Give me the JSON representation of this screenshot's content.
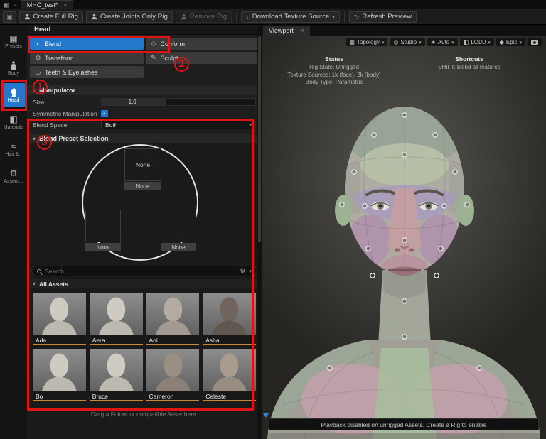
{
  "colors": {
    "accent": "#2478cc",
    "underline": "#c9882e",
    "annotation": "#e01414"
  },
  "titlebar": {
    "tab": "MHC_test*"
  },
  "toolbar": {
    "create_full_rig": "Create Full Rig",
    "create_joints_only_rig": "Create Joints Only Rig",
    "remove_rig": "Remove Rig",
    "download_texture_source": "Download Texture Source",
    "refresh_preview": "Refresh Preview"
  },
  "sidebar": {
    "items": [
      {
        "label": "Presets"
      },
      {
        "label": "Body"
      },
      {
        "label": "Head"
      },
      {
        "label": "Materials"
      },
      {
        "label": "Hair &.."
      },
      {
        "label": "Assem..."
      }
    ]
  },
  "panel": {
    "title": "Head",
    "tools": [
      {
        "label": "Blend"
      },
      {
        "label": "Conform"
      },
      {
        "label": "Transform"
      },
      {
        "label": "Sculpt"
      },
      {
        "label": "Teeth & Eyelashes"
      }
    ],
    "manipulator": {
      "title": "Manipulator",
      "size_label": "Size",
      "size_value": "1.0",
      "symmetric_label": "Symmetric Manipulation",
      "blend_space_label": "Blend Space",
      "blend_space_value": "Both"
    },
    "blend": {
      "title": "Blend Preset Selection",
      "slots": {
        "top": {
          "label": "None",
          "caption": "None"
        },
        "left": {
          "caption": "None"
        },
        "right": {
          "caption": "None"
        }
      },
      "search_placeholder": "Search",
      "all_assets": "All Assets",
      "assets": [
        "Ada",
        "Aera",
        "Aoi",
        "Asha",
        "Bo",
        "Bruce",
        "Cameron",
        "Celeste"
      ],
      "drop_hint": "Drag a Folder or compatible Asset here."
    }
  },
  "viewport": {
    "tab": "Viewport",
    "controls": [
      {
        "label": "Topology"
      },
      {
        "label": "Studio"
      },
      {
        "label": "Auto"
      },
      {
        "label": "LOD0"
      },
      {
        "label": "Epic"
      }
    ],
    "status": {
      "title": "Status",
      "lines": [
        "Rig State: Unrigged",
        "Texture Sources: 1k (face), 2k (body)",
        "Body Type: Parametric"
      ]
    },
    "shortcuts": {
      "title": "Shortcuts",
      "lines": [
        "SHIFT: blend all features"
      ]
    },
    "playback_notice": "Playback disabled on unrigged Assets. Create a Rig to enable"
  },
  "annotations": {
    "n1": "1",
    "n2": "2",
    "n3": "3"
  }
}
